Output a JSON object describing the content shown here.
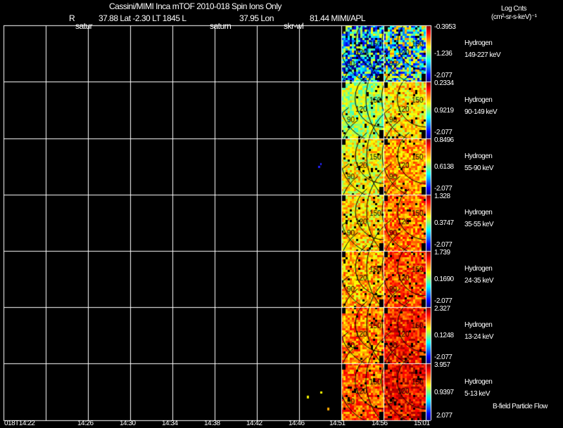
{
  "header": {
    "title": "Cassini/MIMI Inca mTOF  2010-018   Spin   Ions Only",
    "r_label": "R",
    "r_value": "37.88 Lat -2.30 LT 1845 L",
    "l_value": "37.95 Lon",
    "lon_value": "81.44  MIMI/APL",
    "units_line1": "Log Cnts",
    "units_line2": "(cm²-sr-s-keV)⁻¹"
  },
  "markers": [
    "satur",
    "saturn",
    "skr-wl"
  ],
  "chart_data": {
    "type": "heatmap",
    "title": "Cassini/MIMI Inca mTOF  2010-018   Spin   Ions Only",
    "x_ticks": [
      "018T14:22",
      "14:26",
      "14:30",
      "14:34",
      "14:38",
      "14:42",
      "14:46",
      "14:51",
      "14:56",
      "15:01"
    ],
    "contour_labels": [
      "90",
      "120",
      "150"
    ],
    "panels": [
      {
        "species": "Hydrogen",
        "energy": "149-227 keV",
        "max": "-0.3953",
        "mid": "-1.236",
        "min": "-2.077"
      },
      {
        "species": "Hydrogen",
        "energy": "90-149 keV",
        "max": "0.2334",
        "mid": "0.9219",
        "min": "-2.077"
      },
      {
        "species": "Hydrogen",
        "energy": "55-90 keV",
        "max": "0.8496",
        "mid": "0.6138",
        "min": "-2.077"
      },
      {
        "species": "Hydrogen",
        "energy": "35-55 keV",
        "max": "1.328",
        "mid": "0.3747",
        "min": "-2.077"
      },
      {
        "species": "Hydrogen",
        "energy": "24-35 keV",
        "max": "1.739",
        "mid": "0.1690",
        "min": "-2.077"
      },
      {
        "species": "Hydrogen",
        "energy": "13-24 keV",
        "max": "2.327",
        "mid": "0.1248",
        "min": "-2.077"
      },
      {
        "species": "Hydrogen",
        "energy": "5-13 keV",
        "max": "3.957",
        "mid": "0.9397",
        "min": "2.077"
      }
    ],
    "colormap": "jet",
    "grid": true
  },
  "footer": {
    "legend": "B-field Particle Flow"
  }
}
